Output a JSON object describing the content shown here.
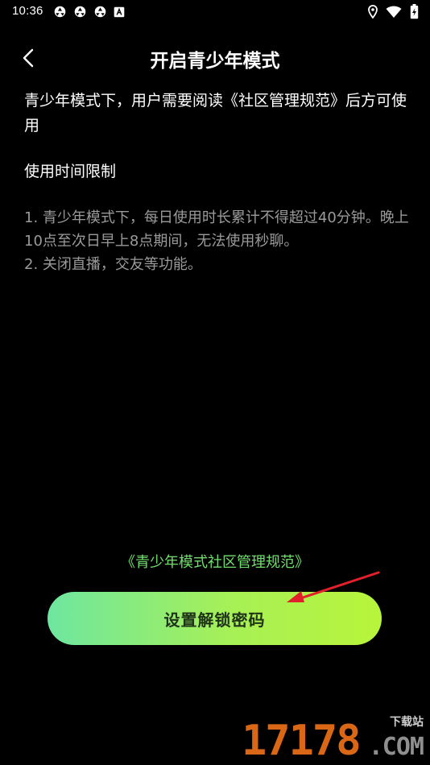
{
  "status_bar": {
    "time": "10:36",
    "left_icons": [
      "app-notification-icon",
      "app-notification-icon",
      "app-notification-icon",
      "a-box-icon"
    ],
    "right_icons": [
      "location-icon",
      "wifi-icon",
      "battery-charging-icon"
    ]
  },
  "header": {
    "back_icon": "chevron-left-icon",
    "title": "开启青少年模式"
  },
  "content": {
    "intro": "青少年模式下，用户需要阅读《社区管理规范》后方可使用",
    "section_title": "使用时间限制",
    "rules": [
      "1. 青少年模式下，每日使用时长累计不得超过40分钟。晚上10点至次日早上8点期间，无法使用秒聊。",
      "2. 关闭直播，交友等功能。"
    ]
  },
  "footer": {
    "rules_link": "《青少年模式社区管理规范》",
    "primary_button": "设置解锁密码"
  },
  "watermark": {
    "digits": "17178",
    "tag": "下载站",
    "domain": ".COM"
  },
  "colors": {
    "background": "#000000",
    "link_green": "#6fe06b",
    "button_gradient_start": "#6ee6a0",
    "button_gradient_end": "#b8f43a",
    "annotation_arrow": "#e0202a",
    "watermark_orange": "#ff7a1a"
  }
}
